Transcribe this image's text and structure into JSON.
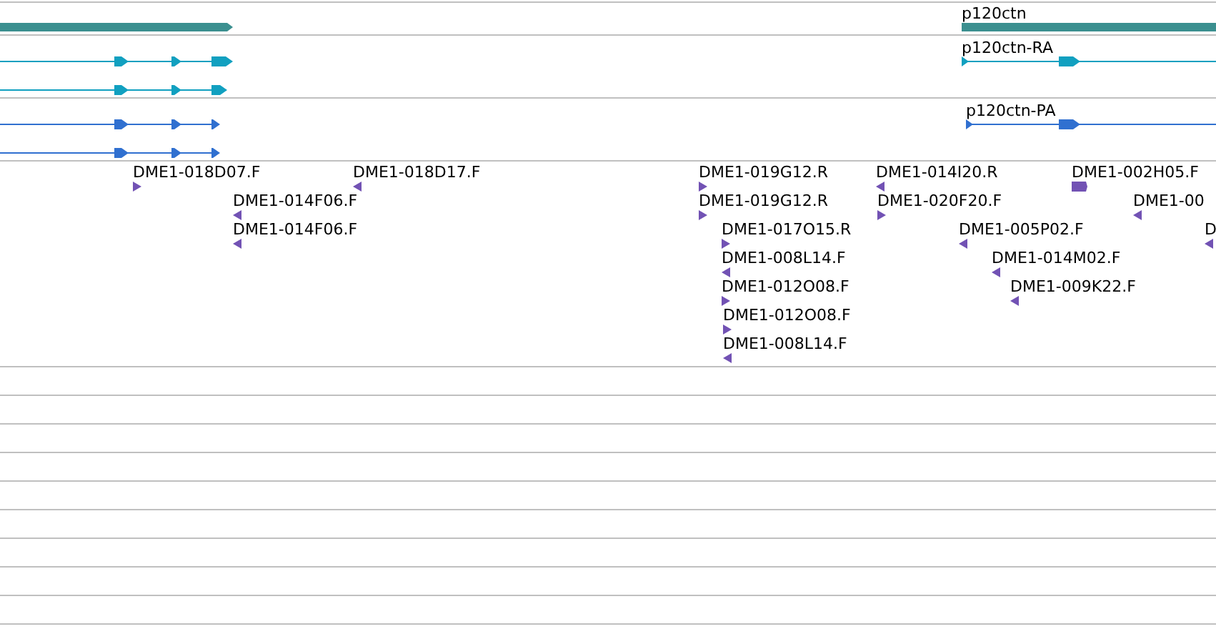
{
  "gene_track": {
    "labels": [
      "p120ctn"
    ]
  },
  "transcript_track": {
    "labels": [
      "p120ctn-RA"
    ]
  },
  "protein_track": {
    "labels": [
      "p120ctn-PA"
    ]
  },
  "est_track": {
    "features": [
      {
        "label": "DME1-018D07.F",
        "kind": "forward"
      },
      {
        "label": "DME1-018D17.F",
        "kind": "reverse"
      },
      {
        "label": "DME1-014F06.F",
        "kind": "reverse"
      },
      {
        "label": "DME1-014F06.F",
        "kind": "reverse"
      },
      {
        "label": "DME1-019G12.R",
        "kind": "forward"
      },
      {
        "label": "DME1-019G12.R",
        "kind": "forward"
      },
      {
        "label": "DME1-017O15.R",
        "kind": "forward"
      },
      {
        "label": "DME1-008L14.F",
        "kind": "reverse"
      },
      {
        "label": "DME1-012O08.F",
        "kind": "forward"
      },
      {
        "label": "DME1-012O08.F",
        "kind": "forward"
      },
      {
        "label": "DME1-008L14.F",
        "kind": "reverse"
      },
      {
        "label": "DME1-014I20.R",
        "kind": "reverse"
      },
      {
        "label": "DME1-020F20.F",
        "kind": "forward"
      },
      {
        "label": "DME1-005P02.F",
        "kind": "reverse"
      },
      {
        "label": "DME1-014M02.F",
        "kind": "reverse"
      },
      {
        "label": "DME1-009K22.F",
        "kind": "reverse"
      },
      {
        "label": "DME1-002H05.F",
        "kind": "forward"
      },
      {
        "label": "DME1-00",
        "kind": "reverse"
      },
      {
        "label": "D",
        "kind": "reverse"
      }
    ]
  }
}
